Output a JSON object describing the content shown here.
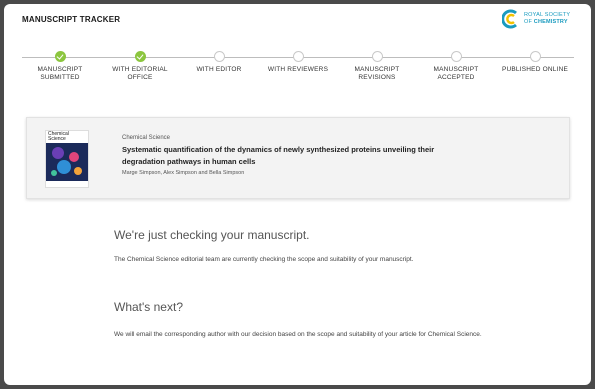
{
  "header": {
    "title": "MANUSCRIPT TRACKER",
    "logo_line1": "ROYAL SOCIETY",
    "logo_line2_prefix": "OF ",
    "logo_line2_bold": "CHEMISTRY"
  },
  "steps": [
    {
      "label": "MANUSCRIPT SUBMITTED",
      "status": "complete"
    },
    {
      "label": "WITH EDITORIAL OFFICE",
      "status": "complete"
    },
    {
      "label": "WITH EDITOR",
      "status": "pending"
    },
    {
      "label": "WITH REVIEWERS",
      "status": "pending"
    },
    {
      "label": "MANUSCRIPT REVISIONS",
      "status": "pending"
    },
    {
      "label": "MANUSCRIPT ACCEPTED",
      "status": "pending"
    },
    {
      "label": "PUBLISHED ONLINE",
      "status": "pending"
    }
  ],
  "manuscript": {
    "cover_title": "Chemical Science",
    "journal": "Chemical Science",
    "title": "Systematic quantification of the dynamics of newly synthesized proteins unveiling their degradation pathways in human cells",
    "authors": "Marge Simpson, Alex Simpson and Bella Simpson"
  },
  "status_section": {
    "heading": "We're just checking your manuscript.",
    "body": "The Chemical Science editorial team are currently checking the scope and suitability of your manuscript."
  },
  "next_section": {
    "heading": "What's next?",
    "body": "We will email the corresponding author with our decision based on the scope and suitability of your article for Chemical Science."
  },
  "colors": {
    "complete": "#8cc63f",
    "brand": "#1a9bbf"
  }
}
